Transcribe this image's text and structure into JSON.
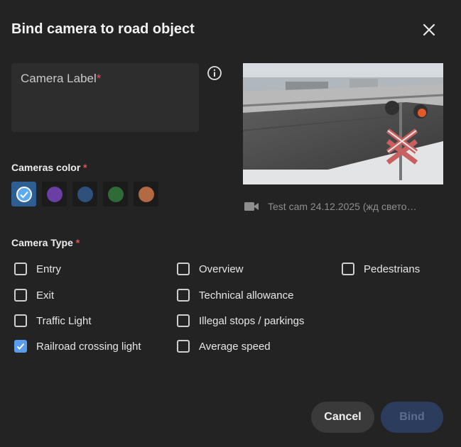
{
  "dialog": {
    "title": "Bind camera to road object",
    "close_icon": "close-icon"
  },
  "camera_label": {
    "label": "Camera Label",
    "required_mark": "*",
    "value": "",
    "info_icon": "info-icon"
  },
  "preview": {
    "camera_icon": "video-camera-icon",
    "caption": "Test cam 24.12.2025 (жд свето…"
  },
  "cameras_color": {
    "label": "Cameras color",
    "required_mark": "*",
    "options": [
      {
        "color": "#5eaaf0",
        "selected": true
      },
      {
        "color": "#6a3fa3",
        "selected": false
      },
      {
        "color": "#2f507a",
        "selected": false
      },
      {
        "color": "#2f6b36",
        "selected": false
      },
      {
        "color": "#b36a42",
        "selected": false
      }
    ]
  },
  "camera_type": {
    "label": "Camera Type",
    "required_mark": "*",
    "options": [
      {
        "label": "Entry",
        "checked": false
      },
      {
        "label": "Exit",
        "checked": false
      },
      {
        "label": "Traffic Light",
        "checked": false
      },
      {
        "label": "Railroad crossing light",
        "checked": true
      },
      {
        "label": "Overview",
        "checked": false
      },
      {
        "label": "Technical allowance",
        "checked": false
      },
      {
        "label": "Illegal stops / parkings",
        "checked": false
      },
      {
        "label": "Average speed",
        "checked": false
      },
      {
        "label": "Pedestrians",
        "checked": false
      }
    ]
  },
  "actions": {
    "cancel_label": "Cancel",
    "bind_label": "Bind",
    "bind_enabled": false
  },
  "colors": {
    "background": "#232323",
    "accent": "#5b9ded",
    "required": "#e05252"
  }
}
